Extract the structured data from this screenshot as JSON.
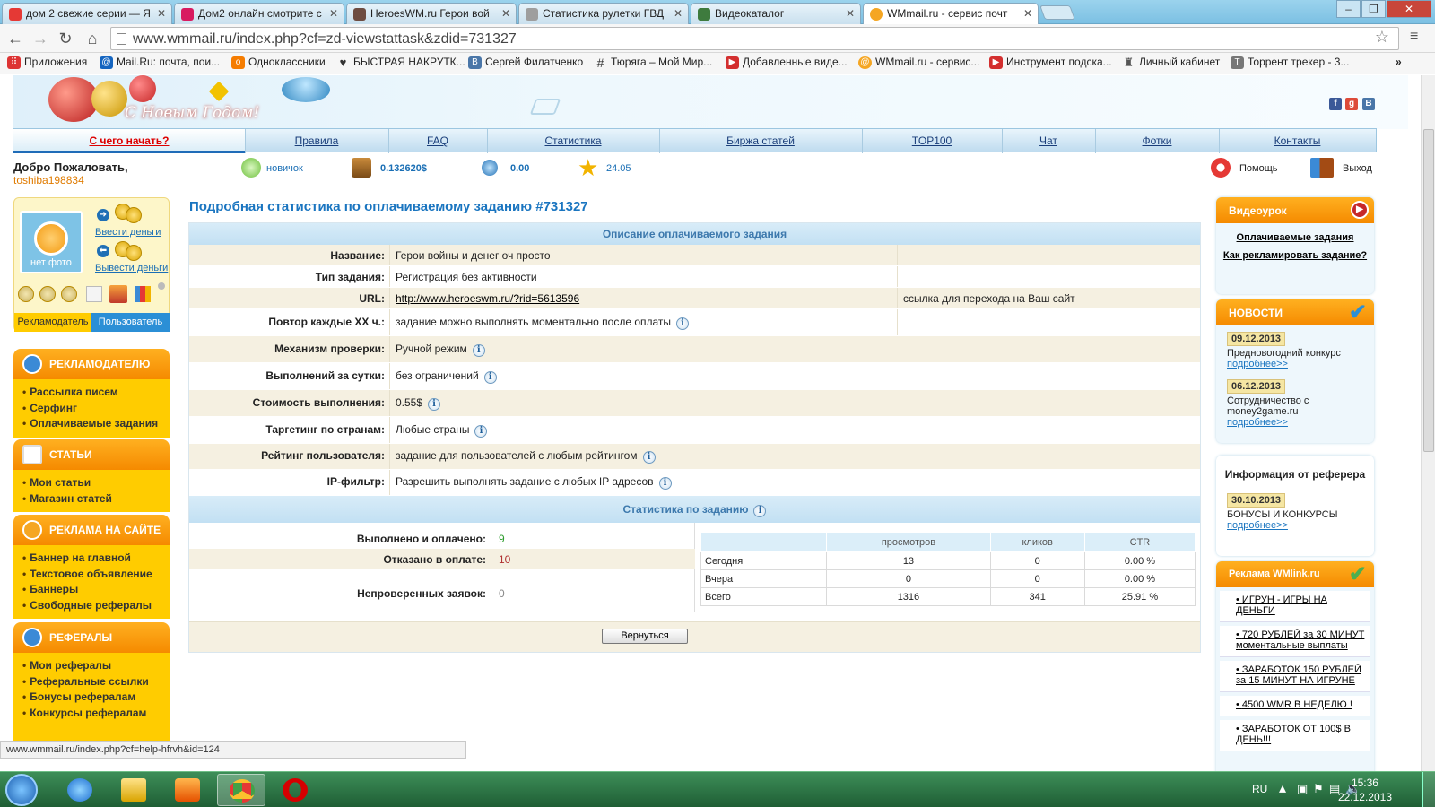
{
  "browser": {
    "tabs": [
      {
        "label": "дом 2 свежие серии — Я",
        "favicon_color": "#e53935",
        "favicon_icon": "yandex-icon"
      },
      {
        "label": "Дом2 онлайн смотрите с",
        "favicon_color": "#d81b60",
        "favicon_icon": "flower-icon"
      },
      {
        "label": "HeroesWM.ru Герои вой",
        "favicon_color": "#6d4c41",
        "favicon_icon": "heroes-icon"
      },
      {
        "label": "Статистика рулетки ГВД",
        "favicon_color": "#9e9e9e",
        "favicon_icon": "shield-icon"
      },
      {
        "label": "Видеокаталог",
        "favicon_color": "#3e7b3e",
        "favicon_icon": "film-icon"
      },
      {
        "label": "WMmail.ru - сервис почт",
        "favicon_color": "#f5a623",
        "favicon_icon": "wmmail-icon",
        "active": true
      }
    ],
    "address": "www.wmmail.ru/index.php?cf=zd-viewstattask&zdid=731327",
    "bookmarks": [
      {
        "label": "Приложения",
        "icon": "apps-icon",
        "color": "#d33"
      },
      {
        "label": "Mail.Ru: почта, пои...",
        "icon": "mailru-icon",
        "color": "#1565c0"
      },
      {
        "label": "Одноклассники",
        "icon": "ok-icon",
        "color": "#f57c00"
      },
      {
        "label": "БЫСТРАЯ НАКРУТК...",
        "icon": "heart-icon",
        "color": "#333"
      },
      {
        "label": "Сергей Филатченко",
        "icon": "vk-icon",
        "color": "#4a76a8"
      },
      {
        "label": "Тюряга – Мой Мир...",
        "icon": "hash-icon",
        "color": "#333"
      },
      {
        "label": "Добавленные виде...",
        "icon": "youtube-icon",
        "color": "#d32f2f"
      },
      {
        "label": "WMmail.ru - сервис...",
        "icon": "wmmail-icon",
        "color": "#f5a623"
      },
      {
        "label": "Инструмент подска...",
        "icon": "youtube-icon",
        "color": "#d32f2f"
      },
      {
        "label": "Личный кабинет",
        "icon": "tower-icon",
        "color": "#555"
      },
      {
        "label": "Торрент трекер - 3...",
        "icon": "torrent-icon",
        "color": "#777"
      }
    ],
    "status_url": "www.wmmail.ru/index.php?cf=help-hfrvh&id=124"
  },
  "site": {
    "banner_text": "С Новым Годом!",
    "nav": [
      "С чего начать?",
      "Правила",
      "FAQ",
      "Статистика",
      "Биржа статей",
      "TOP100",
      "Чат",
      "Фотки",
      "Контакты"
    ],
    "welcome": "Добро Пожаловать,",
    "username": "toshiba198834",
    "level": "новичок",
    "balance": "0.132620$",
    "credits": "0.00",
    "rating": "24.05",
    "help": "Помощь",
    "logout": "Выход"
  },
  "sidebar": {
    "no_photo": "нет фото",
    "deposit": "Ввести деньги",
    "withdraw": "Вывести деньги",
    "role_advertiser": "Рекламодатель",
    "role_user": "Пользователь",
    "sections": [
      {
        "title": "РЕКЛАМОДАТЕЛЮ",
        "items": [
          "Рассылка писем",
          "Серфинг",
          "Оплачиваемые задания"
        ]
      },
      {
        "title": "СТАТЬИ",
        "items": [
          "Мои статьи",
          "Магазин статей"
        ]
      },
      {
        "title": "РЕКЛАМА НА САЙТЕ",
        "items": [
          "Баннер на главной",
          "Текстовое объявление",
          "Баннеры",
          "Свободные рефералы"
        ]
      },
      {
        "title": "РЕФЕРАЛЫ",
        "items": [
          "Мои рефералы",
          "Реферальные ссылки",
          "Бонусы рефералам",
          "Конкурсы рефералам"
        ]
      }
    ]
  },
  "main": {
    "title": "Подробная статистика по оплачиваемому заданию #731327",
    "desc_header": "Описание оплачиваемого задания",
    "fields": {
      "name": {
        "label": "Название:",
        "value": "Герои войны и денег оч просто"
      },
      "type": {
        "label": "Тип задания:",
        "value": "Регистрация без активности"
      },
      "url": {
        "label": "URL:",
        "value": "http://www.heroeswm.ru/?rid=5613596",
        "note": "ссылка для перехода на Ваш сайт"
      },
      "repeat": {
        "label": "Повтор каждые XX ч.:",
        "value": "задание можно выполнять моментально после оплаты"
      },
      "check": {
        "label": "Механизм проверки:",
        "value": "Ручной режим"
      },
      "daily": {
        "label": "Выполнений за сутки:",
        "value": "без ограничений"
      },
      "cost": {
        "label": "Стоимость выполнения:",
        "value": "0.55$"
      },
      "geo": {
        "label": "Таргетинг по странам:",
        "value": "Любые страны"
      },
      "rating": {
        "label": "Рейтинг пользователя:",
        "value": "задание для пользователей с любым рейтингом"
      },
      "ip": {
        "label": "IP-фильтр:",
        "value": "Разрешить выполнять задание с любых IP адресов"
      }
    },
    "stats_header": "Статистика по заданию",
    "done_label": "Выполнено и оплачено:",
    "done_value": "9",
    "rejected_label": "Отказано в оплате:",
    "rejected_value": "10",
    "unchecked_label": "Непроверенных заявок:",
    "unchecked_value": "0",
    "stats_table": {
      "headers": [
        "",
        "просмотров",
        "кликов",
        "CTR"
      ],
      "rows": [
        [
          "Сегодня",
          "13",
          "0",
          "0.00 %"
        ],
        [
          "Вчера",
          "0",
          "0",
          "0.00 %"
        ],
        [
          "Всего",
          "1316",
          "341",
          "25.91 %"
        ]
      ]
    },
    "back_button": "Вернуться"
  },
  "right": {
    "video_title": "Видеоурок",
    "video_links": [
      "Оплачиваемые задания",
      "Как рекламировать задание?"
    ],
    "news_title": "НОВОСТИ",
    "news": [
      {
        "date": "09.12.2013",
        "text": "Предновогодний конкурс",
        "more": "подробнее>>"
      },
      {
        "date": "06.12.2013",
        "text": "Сотрудничество с money2game.ru",
        "more": "подробнее>>"
      }
    ],
    "referer_title": "Информация от реферера",
    "referer": {
      "date": "30.10.2013",
      "text": "БОНУСЫ И КОНКУРСЫ",
      "more": "подробнее>>"
    },
    "wmlink_title": "Реклама WMlink.ru",
    "wmlink_items": [
      "ИГРУН - ИГРЫ НА ДЕНЬГИ",
      "720 РУБЛЕЙ за 30 МИНУТ моментальные выплаты",
      "ЗАРАБОТОК 150 РУБЛЕЙ за 15 МИНУТ НА ИГРУНЕ",
      "4500 WMR В НЕДЕЛЮ !",
      "ЗАРАБОТОК ОТ 100$ В ДЕНЬ!!!"
    ]
  },
  "taskbar": {
    "lang": "RU",
    "time": "15:36",
    "date": "22.12.2013"
  }
}
